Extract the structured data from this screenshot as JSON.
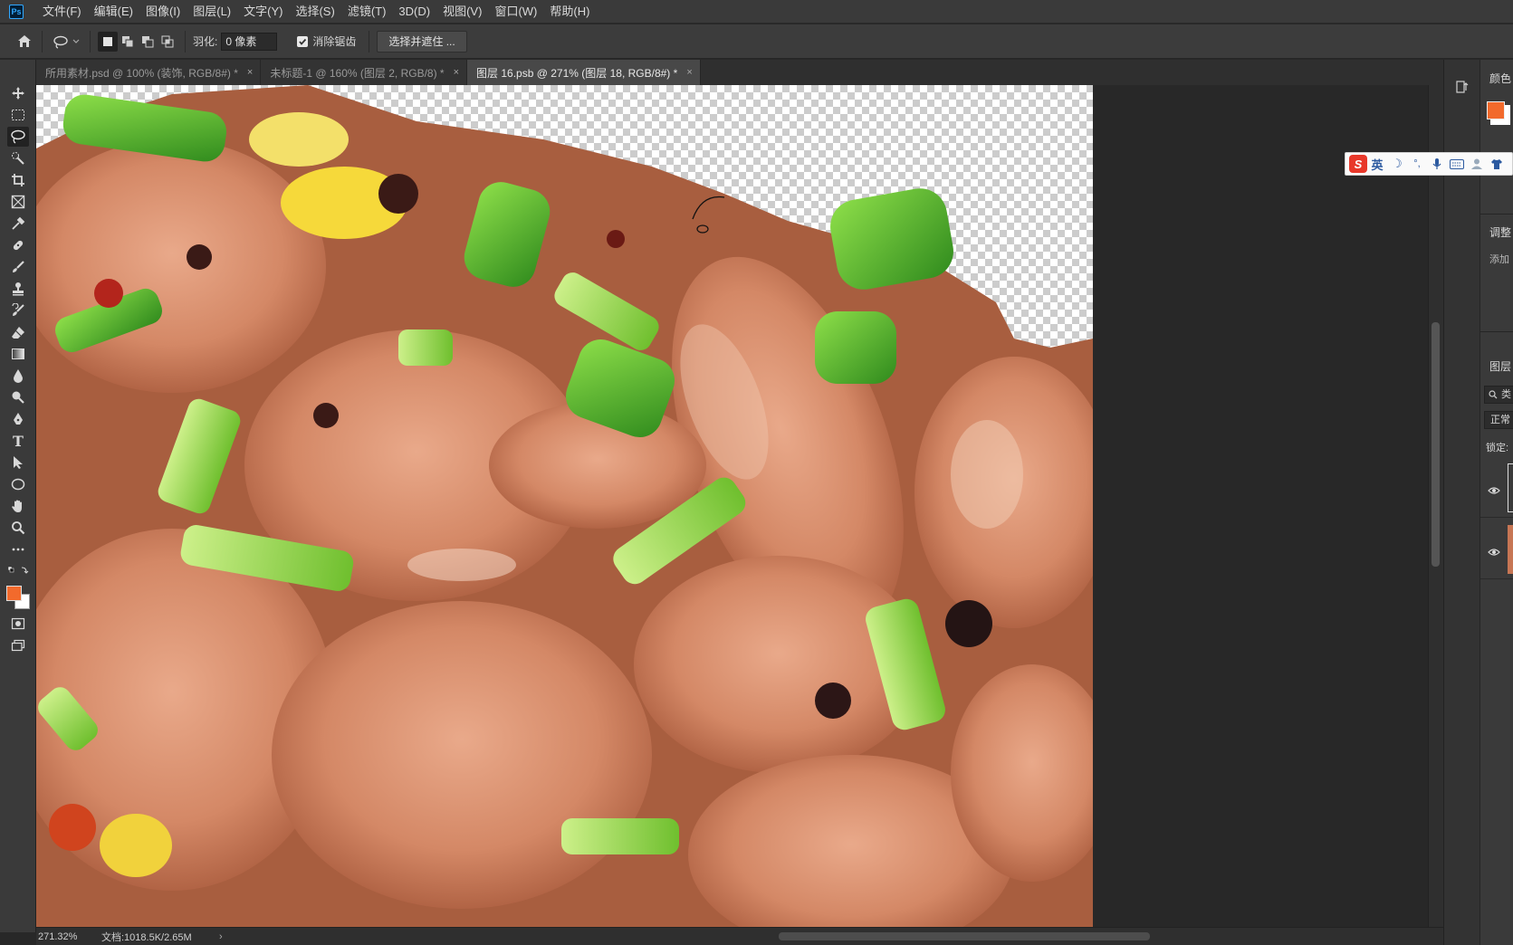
{
  "app": {
    "logo": "Ps",
    "accent_color": "#31a8ff"
  },
  "menu": {
    "items": [
      "文件(F)",
      "编辑(E)",
      "图像(I)",
      "图层(L)",
      "文字(Y)",
      "选择(S)",
      "滤镜(T)",
      "3D(D)",
      "视图(V)",
      "窗口(W)",
      "帮助(H)"
    ]
  },
  "options": {
    "feather_label": "羽化:",
    "feather_value": "0 像素",
    "antialias_label": "消除锯齿",
    "antialias_checked": true,
    "select_mask_label": "选择并遮住 ..."
  },
  "tabs": [
    {
      "label": "所用素材.psd @ 100% (装饰, RGB/8#) *",
      "close": "×",
      "active": false
    },
    {
      "label": "未标题-1 @ 160% (图层 2, RGB/8) *",
      "close": "×",
      "active": false
    },
    {
      "label": "图层 16.psb @ 271% (图层 18, RGB/8#) *",
      "close": "×",
      "active": true
    }
  ],
  "toolbar": {
    "tools": [
      "move-tool-icon",
      "marquee-tool-icon",
      "lasso-tool-icon",
      "quick-select-tool-icon",
      "crop-tool-icon",
      "frame-tool-icon",
      "eyedropper-tool-icon",
      "healing-brush-icon",
      "brush-tool-icon",
      "clone-stamp-icon",
      "history-brush-icon",
      "eraser-tool-icon",
      "gradient-tool-icon",
      "blur-tool-icon",
      "dodge-tool-icon",
      "pen-tool-icon",
      "type-tool-icon",
      "path-select-icon",
      "ellipse-tool-icon",
      "hand-tool-icon",
      "zoom-tool-icon",
      "more-tools-icon"
    ],
    "type_glyph": "T",
    "active_tool": "lasso-tool-icon",
    "foreground_color": "#f26a2c",
    "background_color": "#ffffff"
  },
  "status": {
    "zoom": "271.32%",
    "doc_size": "文档:1018.5K/2.65M",
    "arrow": "›"
  },
  "panels": {
    "color_title": "颜色",
    "swatch_color": "#f26a2c",
    "adjust_title": "调整",
    "adjust_add": "添加",
    "layers_title": "图层",
    "search_hint": "类",
    "blend_mode": "正常",
    "lock_label": "锁定:"
  },
  "ime": {
    "logo": "S",
    "lang": "英",
    "moon": "☽",
    "punct": "°,",
    "mic": "🎤",
    "keyboard": "⌨",
    "user": "👤",
    "shirt": "👕"
  }
}
